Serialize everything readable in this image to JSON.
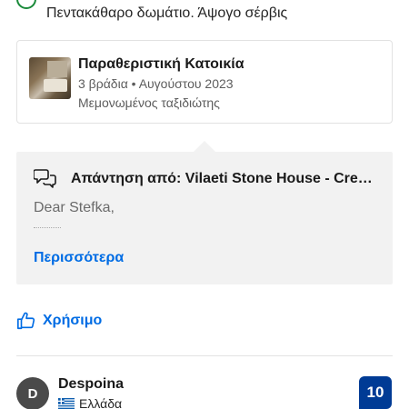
{
  "review_top": {
    "text": "Πεντακάθαρο δωμάτιο. Άψογο σέρβις"
  },
  "property": {
    "name": "Παραθεριστική Κατοικία",
    "stay": "3 βράδια • Αυγούστου 2023",
    "traveler": "Μεμονωμένος ταξιδιώτης"
  },
  "reply": {
    "title": "Απάντηση από: Vilaeti Stone House - Cretan Villas",
    "body": "Dear Stefka,",
    "more_label": "Περισσότερα"
  },
  "helpful": {
    "label": "Χρήσιμο"
  },
  "next_review": {
    "avatar_initial": "D",
    "name": "Despoina",
    "country": "Ελλάδα",
    "score": "10"
  },
  "colors": {
    "link": "#006ce4",
    "score_bg": "#003b95",
    "reply_bg": "#f2f2f2"
  }
}
